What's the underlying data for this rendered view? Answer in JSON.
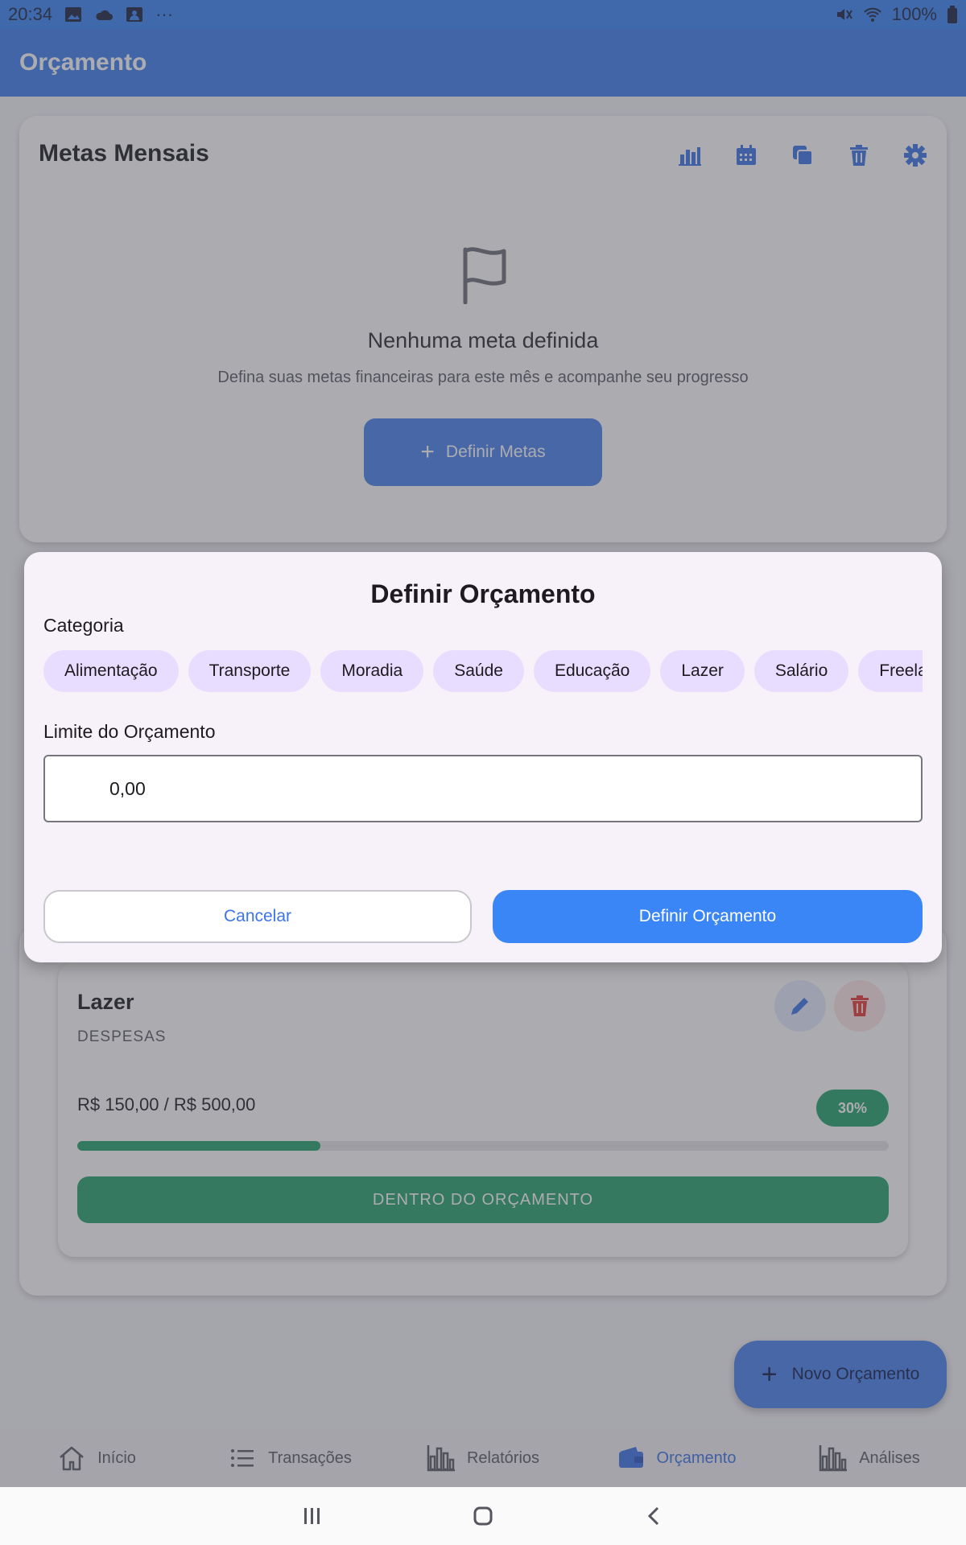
{
  "status_bar": {
    "time": "20:34",
    "more": "···",
    "battery": "100%"
  },
  "app_bar": {
    "title": "Orçamento"
  },
  "goals_card": {
    "title": "Metas Mensais",
    "toolbar_icons": [
      "bar-chart-icon",
      "calendar-icon",
      "copy-icon",
      "trash-icon",
      "gear-icon"
    ],
    "empty_title": "Nenhuma meta definida",
    "empty_subtitle": "Defina suas metas financeiras para este mês e acompanhe seu progresso",
    "define_button": "Definir Metas"
  },
  "budget_item": {
    "category": "Lazer",
    "type": "DESPESAS",
    "amount": "R$ 150,00 / R$ 500,00",
    "percent_label": "30%",
    "progress": 0.3,
    "status": "DENTRO DO ORÇAMENTO"
  },
  "fab": {
    "label": "Novo Orçamento"
  },
  "bottom_nav": [
    {
      "label": "Início",
      "icon": "home-icon"
    },
    {
      "label": "Transações",
      "icon": "list-icon"
    },
    {
      "label": "Relatórios",
      "icon": "bar-chart-icon"
    },
    {
      "label": "Orçamento",
      "icon": "wallet-icon",
      "active": true
    },
    {
      "label": "Análises",
      "icon": "bar-chart-icon"
    }
  ],
  "dialog": {
    "title": "Definir Orçamento",
    "category_label": "Categoria",
    "categories": [
      "Alimentação",
      "Transporte",
      "Moradia",
      "Saúde",
      "Educação",
      "Lazer",
      "Salário",
      "Freelance"
    ],
    "limit_label": "Limite do Orçamento",
    "limit_value": "0,00",
    "cancel_label": "Cancelar",
    "confirm_label": "Definir Orçamento"
  },
  "colors": {
    "primary": "#3b86f6",
    "app_bar": "#3f7ef0",
    "success": "#22a36c",
    "danger": "#e53935",
    "chip": "#e9ddff"
  }
}
